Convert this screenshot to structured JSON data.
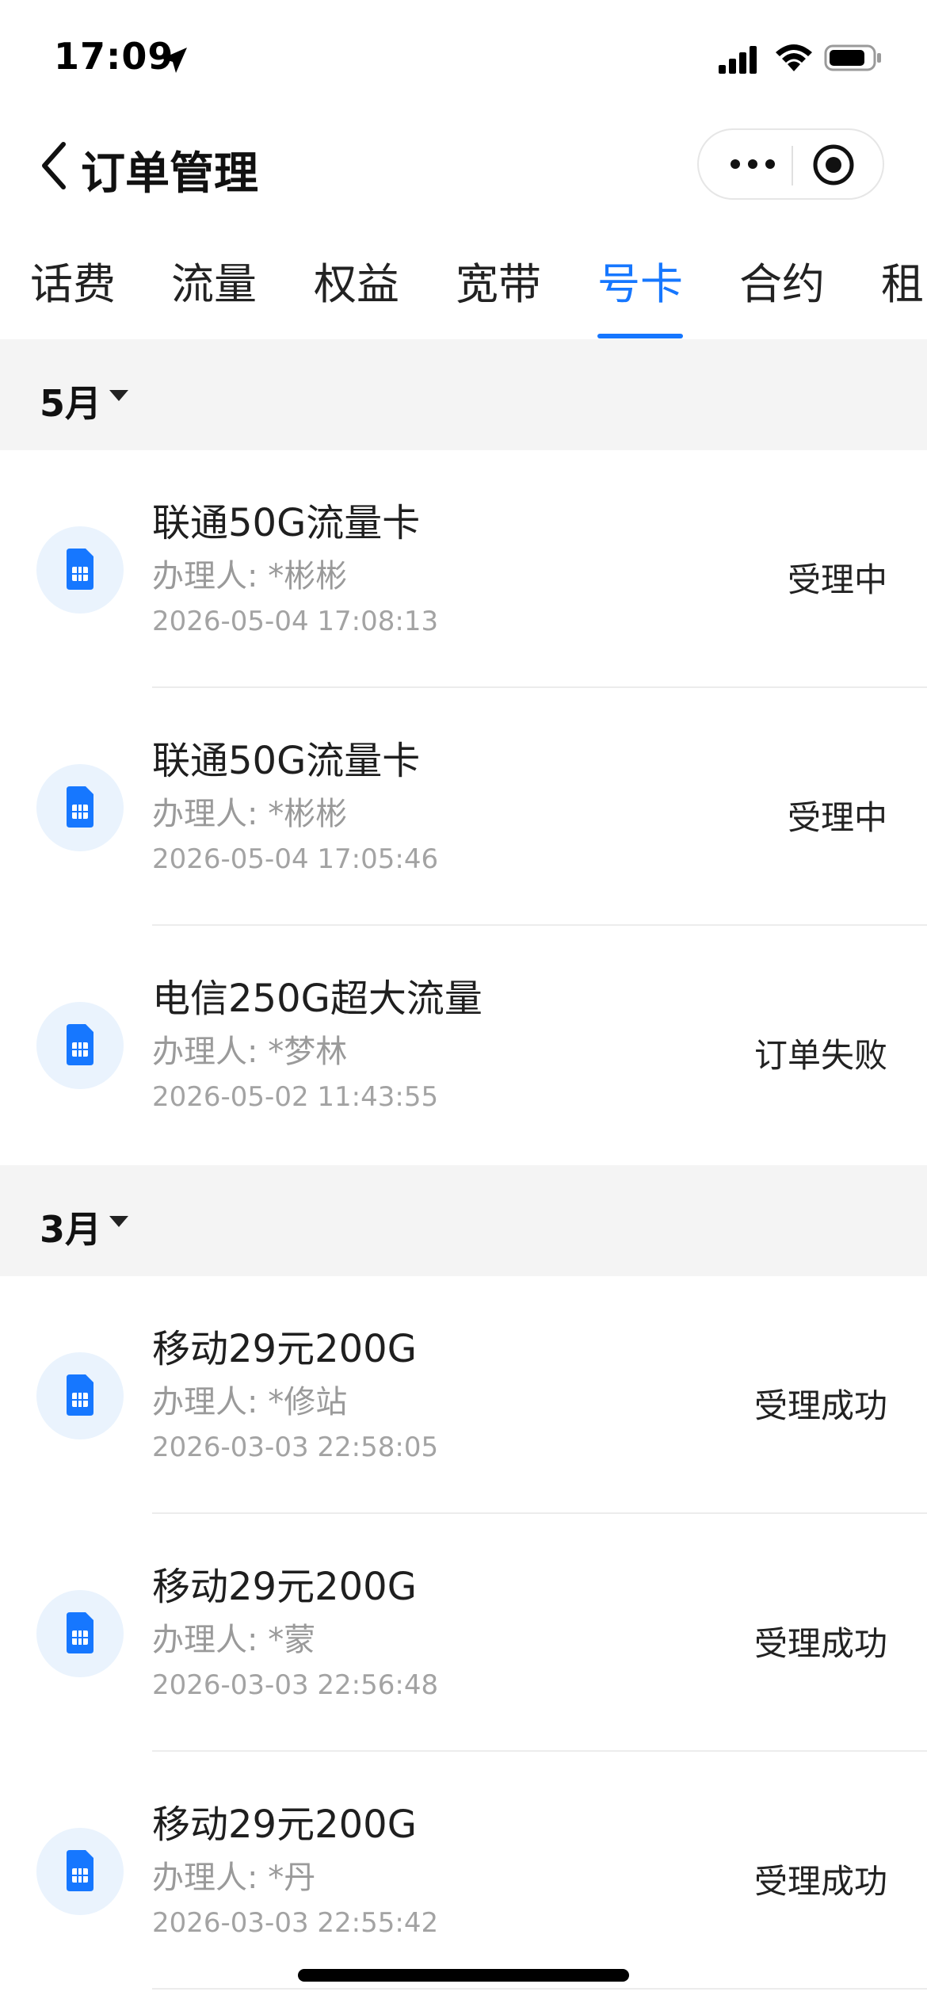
{
  "status_bar": {
    "time": "17:09"
  },
  "nav": {
    "title": "订单管理"
  },
  "tabs": [
    {
      "label": "话费",
      "active": false
    },
    {
      "label": "流量",
      "active": false
    },
    {
      "label": "权益",
      "active": false
    },
    {
      "label": "宽带",
      "active": false
    },
    {
      "label": "号卡",
      "active": true
    },
    {
      "label": "合约",
      "active": false
    },
    {
      "label": "租",
      "active": false
    }
  ],
  "groups": [
    {
      "month": "5月",
      "orders": [
        {
          "name": "联通50G流量卡",
          "handler": "办理人: *彬彬",
          "time": "2026-05-04 17:08:13",
          "status": "受理中"
        },
        {
          "name": "联通50G流量卡",
          "handler": "办理人: *彬彬",
          "time": "2026-05-04 17:05:46",
          "status": "受理中"
        },
        {
          "name": "电信250G超大流量",
          "handler": "办理人: *梦林",
          "time": "2026-05-02 11:43:55",
          "status": "订单失败"
        }
      ]
    },
    {
      "month": "3月",
      "orders": [
        {
          "name": "移动29元200G",
          "handler": "办理人: *修站",
          "time": "2026-03-03 22:58:05",
          "status": "受理成功"
        },
        {
          "name": "移动29元200G",
          "handler": "办理人: *蒙",
          "time": "2026-03-03 22:56:48",
          "status": "受理成功"
        },
        {
          "name": "移动29元200G",
          "handler": "办理人: *丹",
          "time": "2026-03-03 22:55:42",
          "status": "受理成功"
        }
      ]
    }
  ],
  "icons": {
    "order": "sim-card-icon",
    "back": "chevron-left-icon",
    "more": "more-dots-icon",
    "close": "target-circle-icon"
  },
  "colors": {
    "accent": "#1677ff",
    "icon_bg": "#eaf3fd",
    "section_bg": "#f4f4f4"
  }
}
